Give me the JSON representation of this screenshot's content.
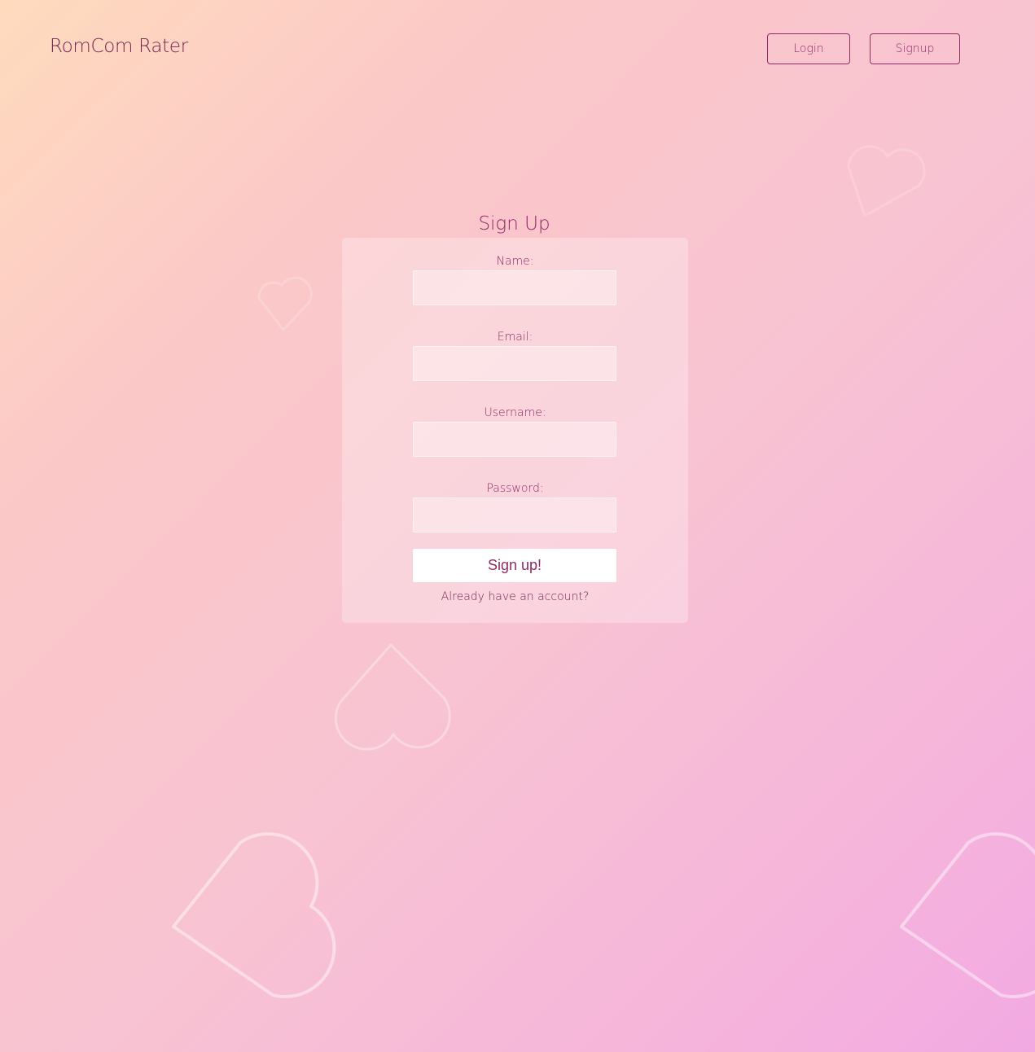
{
  "header": {
    "brand": "RomCom Rater",
    "login_label": "Login",
    "signup_label": "Signup"
  },
  "form": {
    "title": "Sign Up",
    "fields": [
      {
        "label": "Name:",
        "value": "",
        "placeholder": ""
      },
      {
        "label": "Email:",
        "value": "",
        "placeholder": ""
      },
      {
        "label": "Username:",
        "value": "",
        "placeholder": ""
      },
      {
        "label": "Password:",
        "value": "",
        "placeholder": ""
      }
    ],
    "submit_label": "Sign up!",
    "alt_link": "Already have an account?"
  },
  "colors": {
    "accent": "#8f2a66",
    "gradient_start": "#ffdbbd",
    "gradient_end": "#f2a9e2"
  },
  "icons": {
    "background_decoration": "heart-outline-icon"
  }
}
